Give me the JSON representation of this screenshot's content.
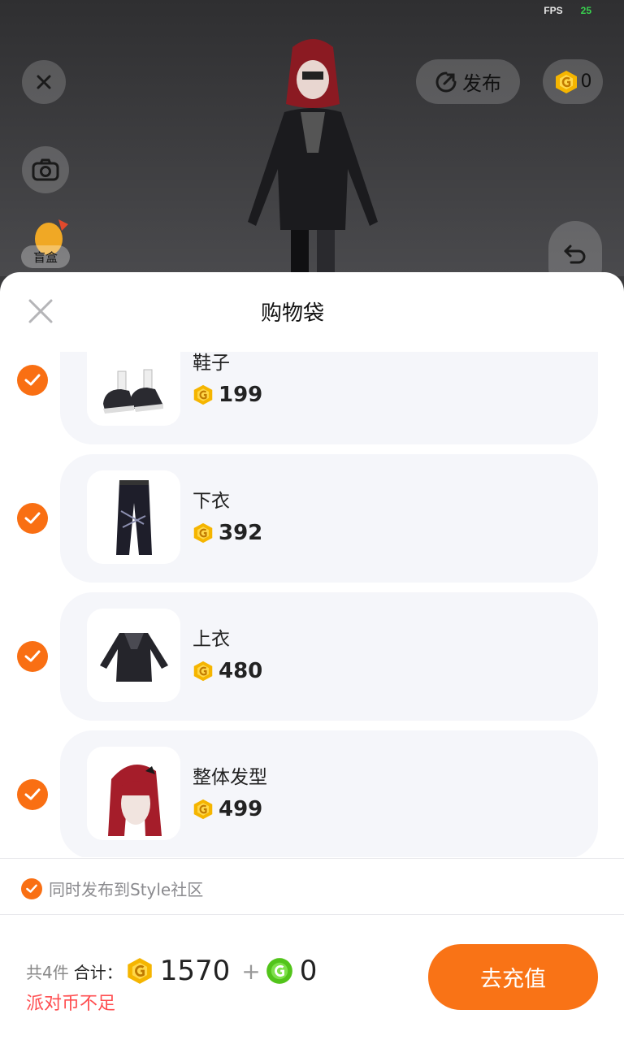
{
  "hud": {
    "fps_label": "FPS",
    "fps_value": "25"
  },
  "top_bar": {
    "publish_label": "发布",
    "coin_balance": "0"
  },
  "left_tools": {
    "blind_box_label": "盲盒"
  },
  "sheet": {
    "title": "购物袋"
  },
  "items": [
    {
      "name": "鞋子",
      "price": "199",
      "icon": "shoes-thumbnail"
    },
    {
      "name": "下衣",
      "price": "392",
      "icon": "pants-thumbnail"
    },
    {
      "name": "上衣",
      "price": "480",
      "icon": "hoodie-thumbnail"
    },
    {
      "name": "整体发型",
      "price": "499",
      "icon": "hairstyle-thumbnail"
    }
  ],
  "publish_option": {
    "label": "同时发布到Style社区",
    "checked": true
  },
  "footer": {
    "count_label": "共4件",
    "total_label": "合计：",
    "gold_total": "1570",
    "plus": "+",
    "green_total": "0",
    "warning": "派对币不足",
    "recharge_label": "去充值"
  },
  "colors": {
    "accent": "#f96f13",
    "warning": "#ff4d4f",
    "coin_gold": "#f5b500",
    "coin_green": "#52c41a"
  }
}
